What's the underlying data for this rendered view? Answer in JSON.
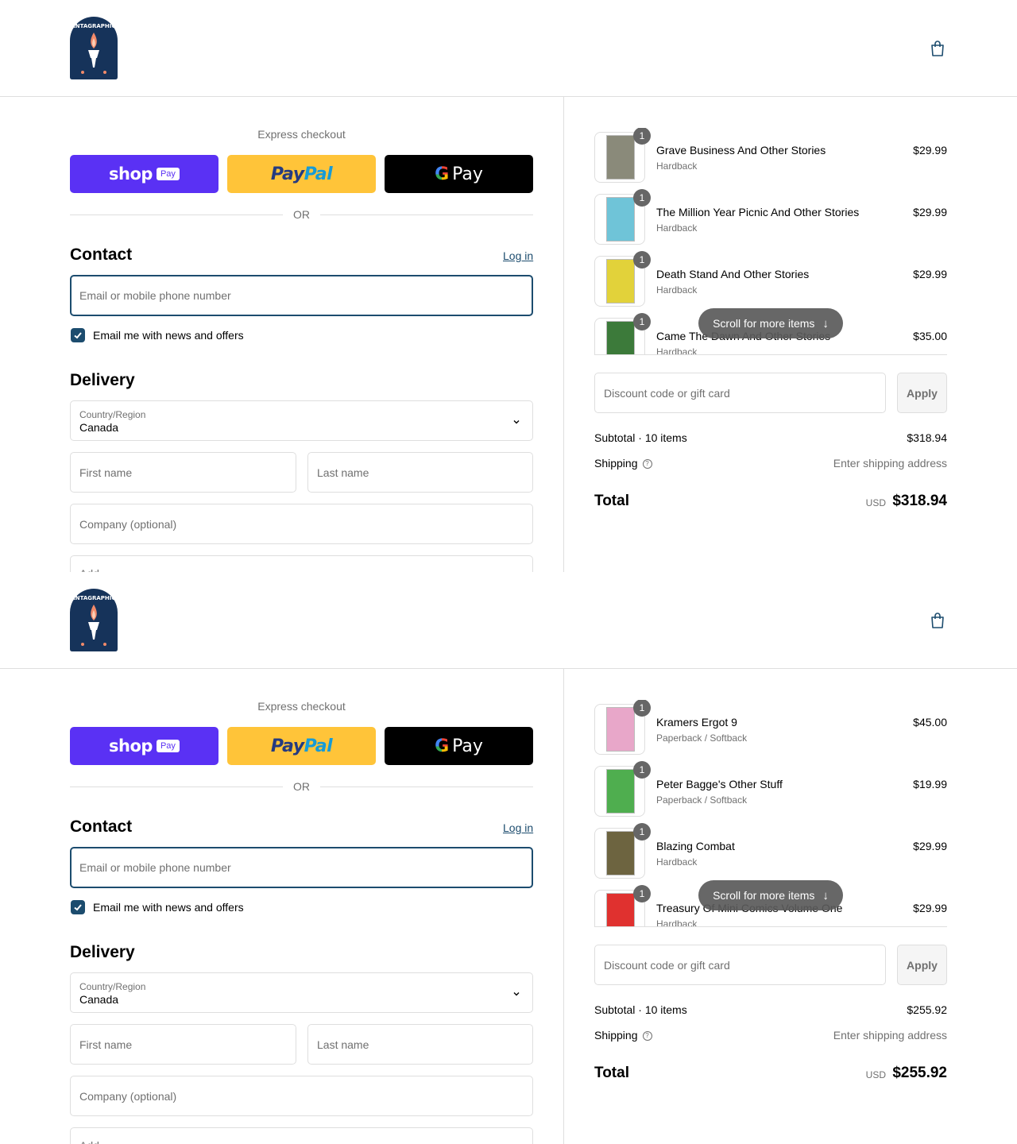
{
  "brand": {
    "name": "FANTAGRAPHICS"
  },
  "express_checkout": {
    "label": "Express checkout",
    "or": "OR",
    "shop_pay": {
      "shop": "shop",
      "pay": "Pay"
    },
    "paypal": {
      "pay": "Pay",
      "pal": "Pal"
    },
    "gpay": {
      "g": "G",
      "pay": "Pay"
    }
  },
  "contact": {
    "heading": "Contact",
    "login": "Log in",
    "email_placeholder": "Email or mobile phone number",
    "newsletter_label": "Email me with news and offers",
    "newsletter_checked": true
  },
  "delivery": {
    "heading": "Delivery",
    "country_label": "Country/Region",
    "country_value": "Canada",
    "first_name": "First name",
    "last_name": "Last name",
    "company": "Company (optional)",
    "address_partial": "Add"
  },
  "views": [
    {
      "items": [
        {
          "qty": "1",
          "name": "Grave Business And Other Stories",
          "variant": "Hardback",
          "price": "$29.99",
          "thumb_color": "#8a8a7a"
        },
        {
          "qty": "1",
          "name": "The Million Year Picnic And Other Stories",
          "variant": "Hardback",
          "price": "$29.99",
          "thumb_color": "#6fc4d8"
        },
        {
          "qty": "1",
          "name": "Death Stand And Other Stories",
          "variant": "Hardback",
          "price": "$29.99",
          "thumb_color": "#e2d23a"
        },
        {
          "qty": "1",
          "name": "Came The Dawn And Other Stories",
          "variant": "Hardback",
          "price": "$35.00",
          "thumb_color": "#3c7a3a"
        }
      ],
      "subtotal_label": "Subtotal · 10 items",
      "subtotal": "$318.94",
      "total": "$318.94"
    },
    {
      "items": [
        {
          "qty": "1",
          "name": "Kramers Ergot 9",
          "variant": "Paperback / Softback",
          "price": "$45.00",
          "thumb_color": "#e8a7c9"
        },
        {
          "qty": "1",
          "name": "Peter Bagge's Other Stuff",
          "variant": "Paperback / Softback",
          "price": "$19.99",
          "thumb_color": "#4fae4f"
        },
        {
          "qty": "1",
          "name": "Blazing Combat",
          "variant": "Hardback",
          "price": "$29.99",
          "thumb_color": "#6d6440"
        },
        {
          "qty": "1",
          "name": "Treasury Of Mini Comics Volume One",
          "variant": "Hardback",
          "price": "$29.99",
          "thumb_color": "#e0312f"
        }
      ],
      "subtotal_label": "Subtotal · 10 items",
      "subtotal": "$255.92",
      "total": "$255.92"
    }
  ],
  "summary": {
    "scroll_hint": "Scroll for more items",
    "discount_placeholder": "Discount code or gift card",
    "apply": "Apply",
    "shipping_label": "Shipping",
    "shipping_value": "Enter shipping address",
    "total_label": "Total",
    "currency": "USD"
  },
  "colors": {
    "accent": "#1c4c6e",
    "shop_pay": "#5a31f4",
    "paypal": "#ffc439"
  }
}
